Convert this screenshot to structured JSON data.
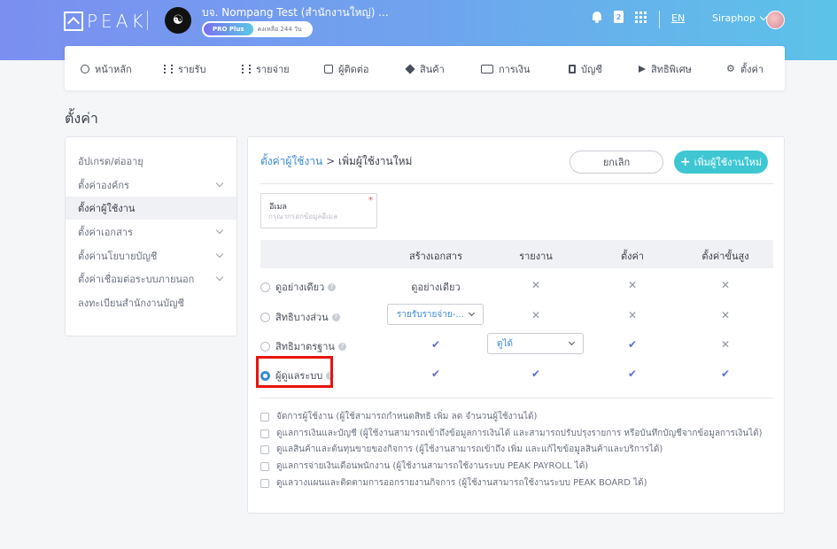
{
  "brand": {
    "logo_text": "PEAK"
  },
  "company": {
    "name": "บจ. Nompang Test (สำนักงานใหญ่) ...",
    "plan": "PRO Plus",
    "remaining": "คงเหลือ 244 วัน"
  },
  "header": {
    "language": "EN",
    "user_name": "Siraphop",
    "doc_badge": "2"
  },
  "menu": [
    "หน้าหลัก",
    "รายรับ",
    "รายจ่าย",
    "ผู้ติดต่อ",
    "สินค้า",
    "การเงิน",
    "บัญชี",
    "สิทธิพิเศษ",
    "ตั้งค่า"
  ],
  "page_title": "ตั้งค่า",
  "sidebar": [
    {
      "label": "อัปเกรด/ต่ออายุ"
    },
    {
      "label": "ตั้งค่าองค์กร"
    },
    {
      "label": "ตั้งค่าผู้ใช้งาน"
    },
    {
      "label": "ตั้งค่าเอกสาร"
    },
    {
      "label": "ตั้งค่านโยบายบัญชี"
    },
    {
      "label": "ตั้งค่าเชื่อมต่อระบบภายนอก"
    },
    {
      "label": "ลงทะเบียนสำนักงานบัญชี"
    }
  ],
  "breadcrumb": {
    "parent": "ตั้งค่าผู้ใช้งาน",
    "sep": ">",
    "current": "เพิ่มผู้ใช้งานใหม่"
  },
  "buttons": {
    "cancel": "ยกเลิก",
    "add": "เพิ่มผู้ใช้งานใหม่",
    "add_plus": "+"
  },
  "email": {
    "label": "อีเมล",
    "placeholder": "กรุณากรอกข้อมูลอีเมล",
    "required": "*"
  },
  "table": {
    "columns": [
      "สร้างเอกสาร",
      "รายงาน",
      "ตั้งค่า",
      "ตั้งค่าขั้นสูง"
    ],
    "rows": [
      {
        "label": "ดูอย่างเดียว",
        "create": "ดูอย่างเดียว",
        "report": "✕",
        "settings": "✕",
        "advanced": "✕"
      },
      {
        "label": "สิทธิบางส่วน",
        "create": "รายรับรายจ่าย-...",
        "report": "✕",
        "settings": "✕",
        "advanced": "✕"
      },
      {
        "label": "สิทธิมาตรฐาน",
        "create": "✔",
        "report": "ดูได้",
        "settings": "✔",
        "advanced": "✕"
      },
      {
        "label": "ผู้ดูแลระบบ",
        "create": "✔",
        "report": "✔",
        "settings": "✔",
        "advanced": "✔"
      }
    ],
    "selected_row": "ผู้ดูแลระบบ"
  },
  "permissions": [
    "จัดการผู้ใช้งาน (ผู้ใช้สามารถกำหนดสิทธิ เพิ่ม ลด จำนวนผู้ใช้งานได้)",
    "ดูแลการเงินและบัญชี (ผู้ใช้งานสามารถเข้าถึงข้อมูลการเงินได้ และสามารถปรับปรุงรายการ หรือบันทึกบัญชีจากข้อมูลการเงินได้)",
    "ดูแลสินค้าและต้นทุนขายของกิจการ (ผู้ใช้งานสามารถเข้าถึง เพิ่ม และแก้ไขข้อมูลสินค้าและบริการได้)",
    "ดูแลการจ่ายเงินเดือนพนักงาน (ผู้ใช้งานสามารถใช้งานระบบ PEAK PAYROLL ได้)",
    "ดูแลวางแผนและติดตามการออกรายงานกิจการ (ผู้ใช้งานสามารถใช้งานระบบ PEAK BOARD ได้)"
  ],
  "colors": {
    "accent": "#3ec7d3",
    "link": "#3a8bd6",
    "check": "#5b6fd6",
    "highlight": "#e8140c"
  }
}
